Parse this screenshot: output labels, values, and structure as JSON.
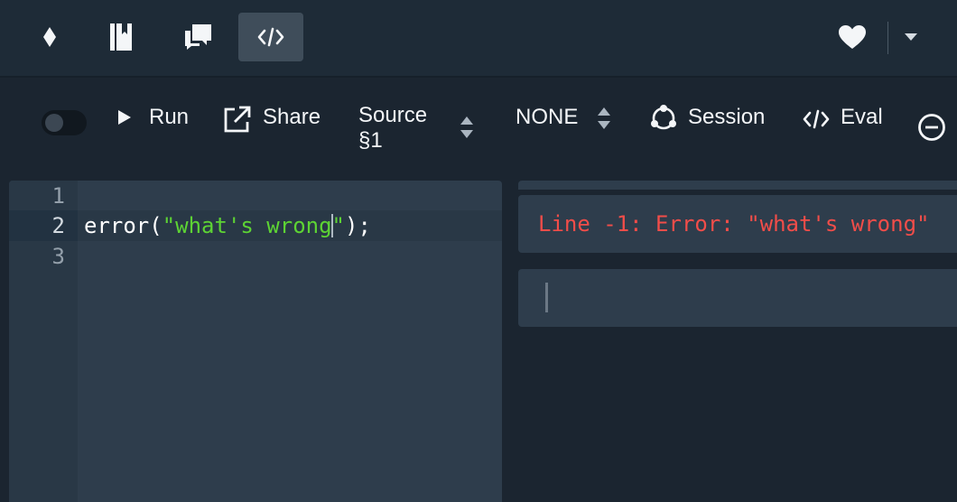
{
  "colors": {
    "background": "#1b2530",
    "navbar": "#1e2b37",
    "active_nav": "#3f4d5a",
    "editor_bg": "#2e3d4c",
    "string": "#5dd334",
    "error": "#f24d49"
  },
  "navbar": {
    "items": [
      {
        "icon": "source-academy-logo-icon"
      },
      {
        "icon": "book-icon"
      },
      {
        "icon": "chat-bubbles-icon"
      },
      {
        "icon": "code-icon",
        "active": true
      }
    ],
    "right": [
      {
        "icon": "heart-icon"
      },
      {
        "icon": "caret-down-icon"
      }
    ]
  },
  "controlbar": {
    "autorun_toggle": {
      "on": false
    },
    "run_label": "Run",
    "share_label": "Share",
    "chapter_line1": "Source",
    "chapter_line2": "§1",
    "variant_label": "NONE",
    "session_label": "Session",
    "eval_label": "Eval"
  },
  "editor": {
    "line_numbers": [
      "1",
      "2",
      "3"
    ],
    "code": {
      "fn": "error(",
      "str_before_caret": "\"what's wrong",
      "str_after_caret": "\"",
      "rest": ");"
    }
  },
  "repl": {
    "output": "Line -1: Error: \"what's wrong\""
  }
}
